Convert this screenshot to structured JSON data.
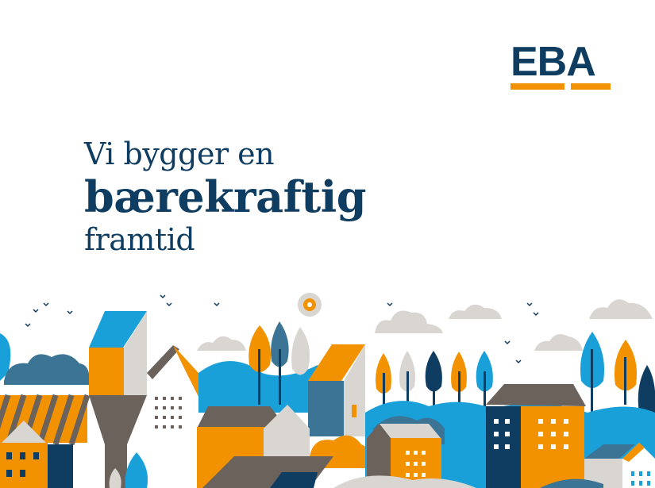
{
  "logo": {
    "text": "EBA"
  },
  "headline": {
    "line1": "Vi bygger en",
    "line2": "bærekraftig",
    "line3": "framtid"
  },
  "colors": {
    "navy": "#0f3d62",
    "orange": "#f39200",
    "light_blue": "#1aa0d8",
    "steel_blue": "#3b7494",
    "taupe": "#6b625c",
    "light_gray": "#d9d6d2"
  }
}
